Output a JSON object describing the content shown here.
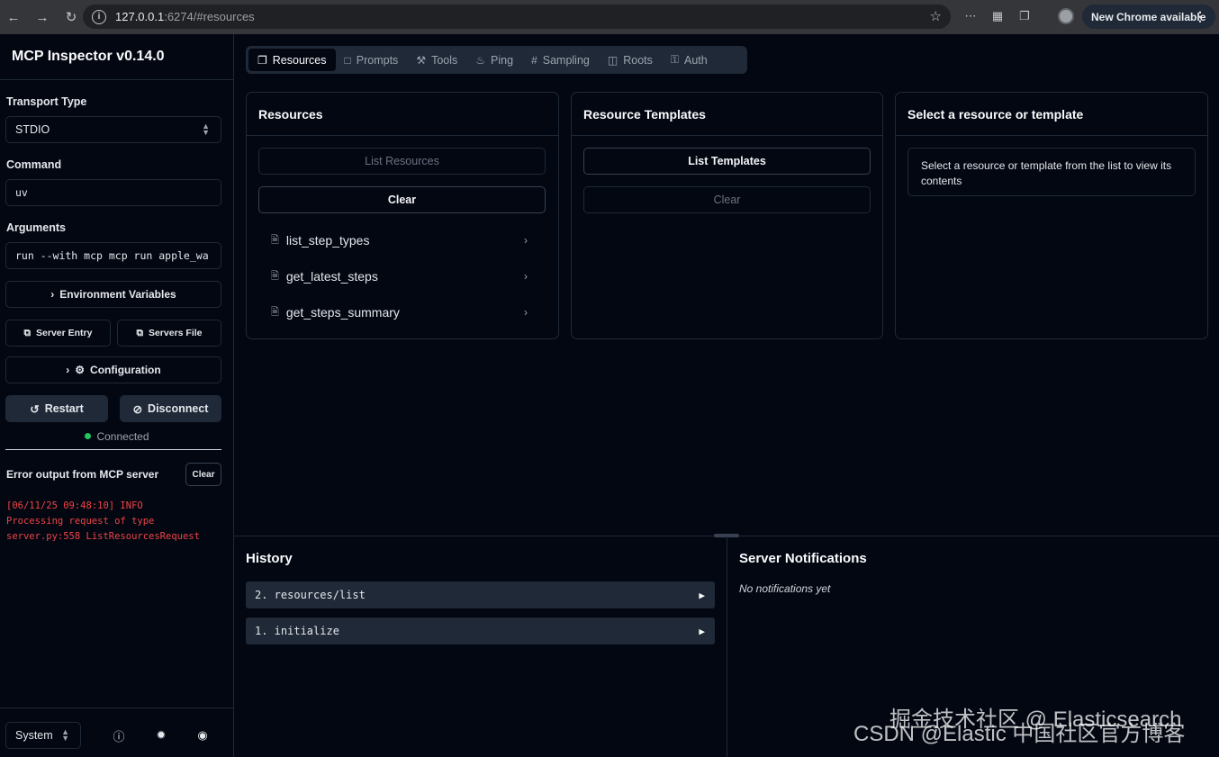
{
  "browser": {
    "url_host": "127.0.0.1",
    "url_rest": ":6274/#resources",
    "update_label": "New Chrome available"
  },
  "sidebar": {
    "title": "MCP Inspector v0.14.0",
    "transport_label": "Transport Type",
    "transport_value": "STDIO",
    "command_label": "Command",
    "command_value": "uv",
    "arguments_label": "Arguments",
    "arguments_value": "run --with mcp mcp run apple_wa",
    "env_button": "Environment Variables",
    "server_entry_button": "Server Entry",
    "servers_file_button": "Servers File",
    "configuration_button": "Configuration",
    "restart_button": "Restart",
    "disconnect_button": "Disconnect",
    "status": "Connected",
    "error_title": "Error output from MCP server",
    "error_clear": "Clear",
    "error_log": "[06/11/25 09:48:10] INFO\nProcessing request of type\nserver.py:558 ListResourcesRequest",
    "theme_value": "System"
  },
  "tabs": [
    {
      "label": "Resources",
      "icon": "file-stack-icon"
    },
    {
      "label": "Prompts",
      "icon": "message-square-icon"
    },
    {
      "label": "Tools",
      "icon": "hammer-icon"
    },
    {
      "label": "Ping",
      "icon": "bell-icon"
    },
    {
      "label": "Sampling",
      "icon": "hash-icon"
    },
    {
      "label": "Roots",
      "icon": "folder-tree-icon"
    },
    {
      "label": "Auth",
      "icon": "key-icon"
    }
  ],
  "resources_panel": {
    "title": "Resources",
    "list_button": "List Resources",
    "clear_button": "Clear",
    "items": [
      "list_step_types",
      "get_latest_steps",
      "get_steps_summary"
    ]
  },
  "templates_panel": {
    "title": "Resource Templates",
    "list_button": "List Templates",
    "clear_button": "Clear"
  },
  "detail_panel": {
    "title": "Select a resource or template",
    "hint": "Select a resource or template from the list to view its contents"
  },
  "history": {
    "title": "History",
    "items": [
      "2. resources/list",
      "1. initialize"
    ]
  },
  "notifications": {
    "title": "Server Notifications",
    "empty": "No notifications yet"
  },
  "watermark": {
    "line1": "掘金技术社区 @ Elasticsearch",
    "line2": "CSDN @Elastic 中国社区官方博客"
  },
  "colors": {
    "background": "#030712",
    "border": "#1f2937",
    "error": "#ef4444",
    "connected": "#22c55e"
  }
}
